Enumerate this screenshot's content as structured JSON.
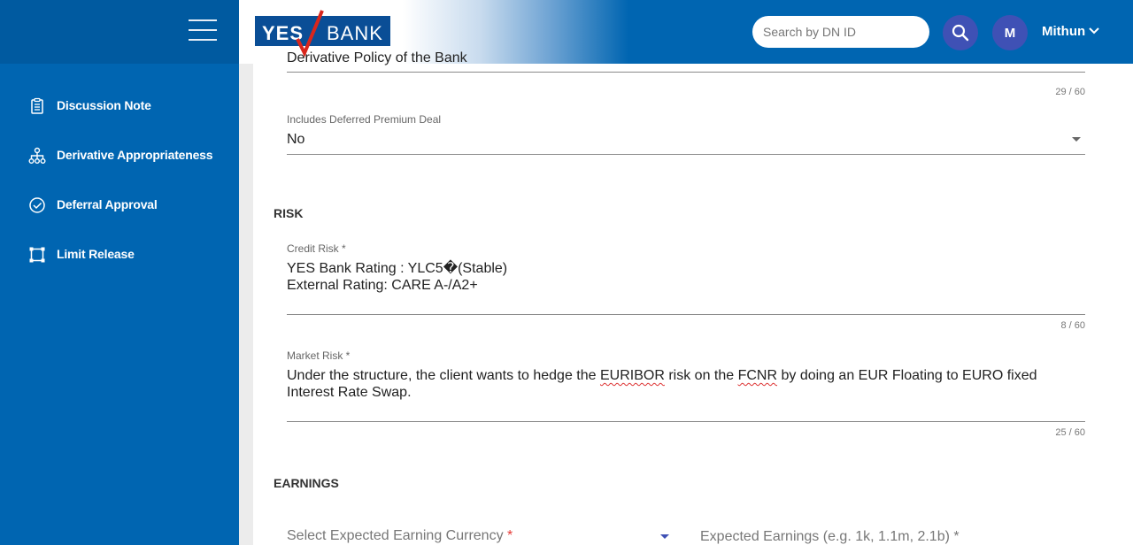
{
  "header": {
    "logo_yes": "YES",
    "logo_bank": "BANK",
    "search_placeholder": "Search by DN ID",
    "avatar_initial": "M",
    "user_name": "Mithun"
  },
  "sidebar": {
    "items": [
      {
        "label": "Discussion Note",
        "icon": "clipboard-icon"
      },
      {
        "label": "Derivative Appropriateness",
        "icon": "hierarchy-icon"
      },
      {
        "label": "Deferral Approval",
        "icon": "check-circle-icon"
      },
      {
        "label": "Limit Release",
        "icon": "frame-icon"
      }
    ]
  },
  "form": {
    "derivative_policy": {
      "value": "Derivative Policy of the Bank",
      "counter": "29 / 60"
    },
    "deferred_premium": {
      "label": "Includes Deferred Premium Deal",
      "value": "No"
    },
    "risk_title": "RISK",
    "credit_risk": {
      "label": "Credit Risk *",
      "value": "YES Bank Rating : YLC5�(Stable)\nExternal Rating: CARE A-/A2+",
      "counter": "8 / 60"
    },
    "market_risk": {
      "label": "Market Risk *",
      "text_parts": [
        "Under the structure, the client wants to hedge the ",
        "EURIBOR",
        " risk on the ",
        "FCNR",
        " by doing an EUR Floating to EURO fixed",
        "Interest Rate Swap."
      ],
      "counter": "25 / 60"
    },
    "earnings_title": "EARNINGS",
    "earning_currency": {
      "placeholder": "Select Expected Earning Currency",
      "required_mark": "*"
    },
    "expected_earnings": {
      "placeholder": "Expected Earnings (e.g. 1k, 1.1m, 2.1b) *"
    }
  },
  "colors": {
    "primary": "#0065b1",
    "accent": "#3f51b5",
    "required": "#e53935"
  }
}
